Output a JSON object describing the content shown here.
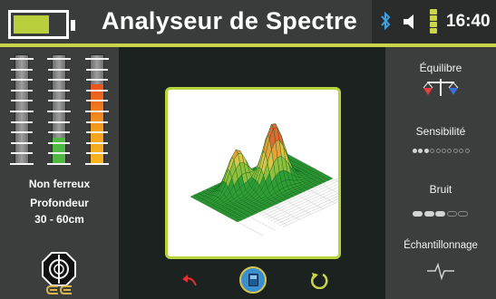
{
  "header": {
    "title": "Analyseur de Spectre",
    "time": "16:40",
    "battery_level": 0.7,
    "icons": [
      "battery-icon",
      "bluetooth-icon",
      "speaker-icon",
      "signal-icon"
    ]
  },
  "left_panel": {
    "gauge_levels": [
      0,
      0.24,
      0.73
    ],
    "gauge_colors": [
      "#4fb842",
      "#f3a21e"
    ],
    "ferrous_label": "Non ferreux",
    "depth_label": "Profondeur",
    "depth_value": "30 -  60cm",
    "coil_icon": "coil-icon",
    "brand_logo": "ce"
  },
  "center": {
    "undo_icon": "undo-arrow-icon",
    "save_icon": "save-icon",
    "redo_icon": "redo-arrow-icon"
  },
  "right_panel": {
    "balance_label": "Équilibre",
    "sensitivity_label": "Sensibilité",
    "sensitivity_level": 3,
    "sensitivity_max": 10,
    "noise_label": "Bruit",
    "noise_level": 3,
    "noise_max": 5,
    "sampling_label": "Échantillonnage"
  },
  "colors": {
    "accent": "#c9d64a",
    "panel": "#3c3d3d",
    "surface_green": "#2f9f35",
    "peak_top": "#e2683a"
  }
}
